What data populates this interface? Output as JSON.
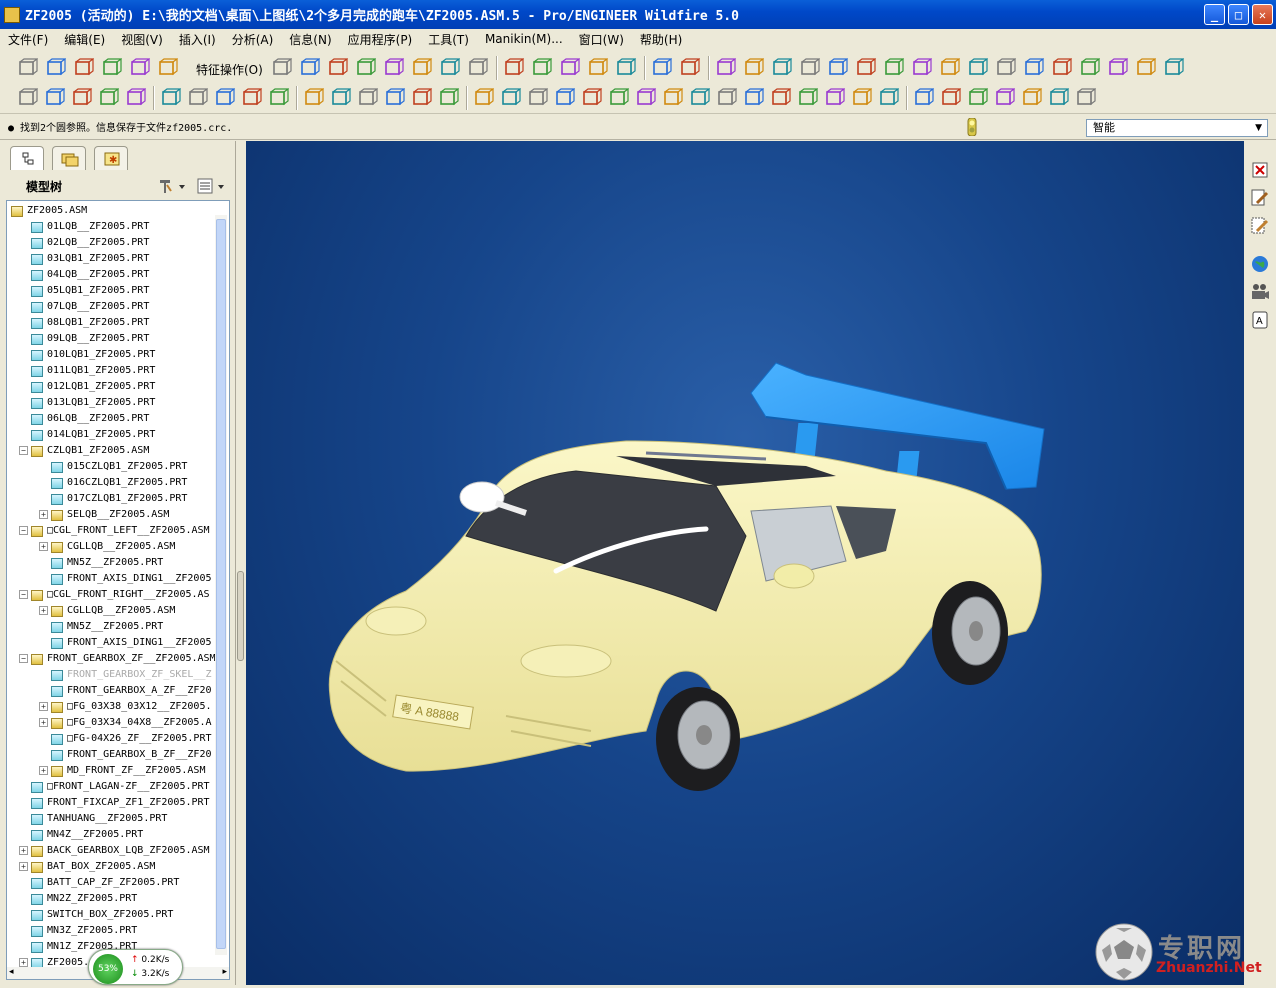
{
  "window": {
    "title": "ZF2005 (活动的) E:\\我的文档\\桌面\\上图纸\\2个多月完成的跑车\\ZF2005.ASM.5 - Pro/ENGINEER Wildfire 5.0"
  },
  "menu": [
    "文件(F)",
    "编辑(E)",
    "视图(V)",
    "插入(I)",
    "分析(A)",
    "信息(N)",
    "应用程序(P)",
    "工具(T)",
    "Manikin(M)...",
    "窗口(W)",
    "帮助(H)"
  ],
  "toolbar": {
    "feature_ops_label": "特征操作(O)"
  },
  "message": {
    "text": "● 找到2个圆参照。信息保存于文件zf2005.crc."
  },
  "filter": {
    "value": "智能"
  },
  "navigator": {
    "tree_title": "模型树",
    "items": [
      {
        "label": "ZF2005.ASM",
        "level": 0,
        "type": "asm",
        "expander": ""
      },
      {
        "label": "01LQB__ZF2005.PRT",
        "level": 1,
        "type": "prt",
        "expander": ""
      },
      {
        "label": "02LQB__ZF2005.PRT",
        "level": 1,
        "type": "prt",
        "expander": ""
      },
      {
        "label": "03LQB1_ZF2005.PRT",
        "level": 1,
        "type": "prt",
        "expander": ""
      },
      {
        "label": "04LQB__ZF2005.PRT",
        "level": 1,
        "type": "prt",
        "expander": ""
      },
      {
        "label": "05LQB1_ZF2005.PRT",
        "level": 1,
        "type": "prt",
        "expander": ""
      },
      {
        "label": "07LQB__ZF2005.PRT",
        "level": 1,
        "type": "prt",
        "expander": ""
      },
      {
        "label": "08LQB1_ZF2005.PRT",
        "level": 1,
        "type": "prt",
        "expander": ""
      },
      {
        "label": "09LQB__ZF2005.PRT",
        "level": 1,
        "type": "prt",
        "expander": ""
      },
      {
        "label": "010LQB1_ZF2005.PRT",
        "level": 1,
        "type": "prt",
        "expander": ""
      },
      {
        "label": "011LQB1_ZF2005.PRT",
        "level": 1,
        "type": "prt",
        "expander": ""
      },
      {
        "label": "012LQB1_ZF2005.PRT",
        "level": 1,
        "type": "prt",
        "expander": ""
      },
      {
        "label": "013LQB1_ZF2005.PRT",
        "level": 1,
        "type": "prt",
        "expander": ""
      },
      {
        "label": "06LQB__ZF2005.PRT",
        "level": 1,
        "type": "prt",
        "expander": ""
      },
      {
        "label": "014LQB1_ZF2005.PRT",
        "level": 1,
        "type": "prt",
        "expander": ""
      },
      {
        "label": "CZLQB1_ZF2005.ASM",
        "level": 1,
        "type": "asm",
        "expander": "−"
      },
      {
        "label": "015CZLQB1_ZF2005.PRT",
        "level": 2,
        "type": "prt",
        "expander": ""
      },
      {
        "label": "016CZLQB1_ZF2005.PRT",
        "level": 2,
        "type": "prt",
        "expander": ""
      },
      {
        "label": "017CZLQB1_ZF2005.PRT",
        "level": 2,
        "type": "prt",
        "expander": ""
      },
      {
        "label": "SELQB__ZF2005.ASM",
        "level": 2,
        "type": "asm",
        "expander": "+"
      },
      {
        "label": "□CGL_FRONT_LEFT__ZF2005.ASM",
        "level": 1,
        "type": "asm",
        "expander": "−"
      },
      {
        "label": "CGLLQB__ZF2005.ASM",
        "level": 2,
        "type": "asm",
        "expander": "+"
      },
      {
        "label": "MN5Z__ZF2005.PRT",
        "level": 2,
        "type": "prt",
        "expander": ""
      },
      {
        "label": "FRONT_AXIS_DING1__ZF2005",
        "level": 2,
        "type": "prt",
        "expander": ""
      },
      {
        "label": "□CGL_FRONT_RIGHT__ZF2005.AS",
        "level": 1,
        "type": "asm",
        "expander": "−"
      },
      {
        "label": "CGLLQB__ZF2005.ASM",
        "level": 2,
        "type": "asm",
        "expander": "+"
      },
      {
        "label": "MN5Z__ZF2005.PRT",
        "level": 2,
        "type": "prt",
        "expander": ""
      },
      {
        "label": "FRONT_AXIS_DING1__ZF2005",
        "level": 2,
        "type": "prt",
        "expander": ""
      },
      {
        "label": "FRONT_GEARBOX_ZF__ZF2005.ASM",
        "level": 1,
        "type": "asm",
        "expander": "−"
      },
      {
        "label": "FRONT_GEARBOX_ZF_SKEL__Z",
        "level": 2,
        "type": "dim",
        "expander": ""
      },
      {
        "label": "FRONT_GEARBOX_A_ZF__ZF20",
        "level": 2,
        "type": "prt",
        "expander": ""
      },
      {
        "label": "□FG_03X38_03X12__ZF2005.",
        "level": 2,
        "type": "asm",
        "expander": "+"
      },
      {
        "label": "□FG_03X34_04X8__ZF2005.A",
        "level": 2,
        "type": "asm",
        "expander": "+"
      },
      {
        "label": "□FG-04X26_ZF__ZF2005.PRT",
        "level": 2,
        "type": "prt",
        "expander": ""
      },
      {
        "label": "FRONT_GEARBOX_B_ZF__ZF20",
        "level": 2,
        "type": "prt",
        "expander": ""
      },
      {
        "label": "MD_FRONT_ZF__ZF2005.ASM",
        "level": 2,
        "type": "asm",
        "expander": "+"
      },
      {
        "label": "□FRONT_LAGAN-ZF__ZF2005.PRT",
        "level": 1,
        "type": "prt",
        "expander": ""
      },
      {
        "label": "FRONT_FIXCAP_ZF1_ZF2005.PRT",
        "level": 1,
        "type": "prt",
        "expander": ""
      },
      {
        "label": "TANHUANG__ZF2005.PRT",
        "level": 1,
        "type": "prt",
        "expander": ""
      },
      {
        "label": "MN4Z__ZF2005.PRT",
        "level": 1,
        "type": "prt",
        "expander": ""
      },
      {
        "label": "BACK_GEARBOX_LQB_ZF2005.ASM",
        "level": 1,
        "type": "asm",
        "expander": "+"
      },
      {
        "label": "BAT_BOX_ZF2005.ASM",
        "level": 1,
        "type": "asm",
        "expander": "+"
      },
      {
        "label": "BATT_CAP_ZF_ZF2005.PRT",
        "level": 1,
        "type": "prt",
        "expander": ""
      },
      {
        "label": "MN2Z_ZF2005.PRT",
        "level": 1,
        "type": "prt",
        "expander": ""
      },
      {
        "label": "SWITCH_BOX_ZF2005.PRT",
        "level": 1,
        "type": "prt",
        "expander": ""
      },
      {
        "label": "MN3Z_ZF2005.PRT",
        "level": 1,
        "type": "prt",
        "expander": ""
      },
      {
        "label": "MN1Z_ZF2005.PRT",
        "level": 1,
        "type": "prt",
        "expander": ""
      },
      {
        "label": "ZF2005.",
        "level": 1,
        "type": "prt",
        "expander": "+"
      }
    ]
  },
  "netmon": {
    "percent": "53%",
    "up": "0.2K/s",
    "down": "3.2K/s"
  },
  "viewport": {
    "plate_text": "粤 A 88888"
  },
  "watermark": {
    "cn": "专职网",
    "url": "Zhuanzhi.Net"
  },
  "colors": {
    "body": "#f2eda8",
    "wing": "#2a9af0",
    "background": "#0f3a7a"
  }
}
